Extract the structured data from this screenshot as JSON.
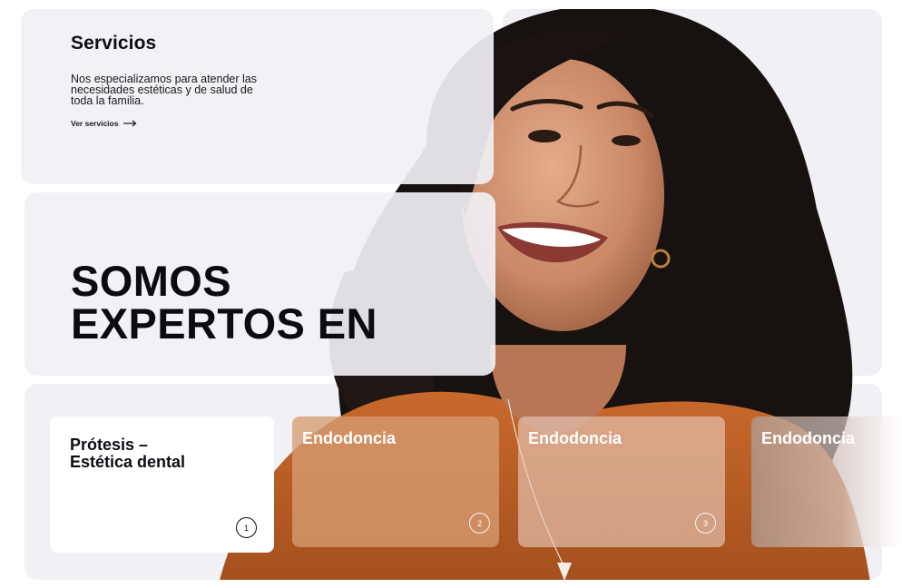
{
  "servicios": {
    "title": "Servicios",
    "description": "Nos especializamos para atender las necesidades estéticas y de salud de toda la familia.",
    "link_label": "Ver servicios",
    "link_icon": "arrow-right-icon"
  },
  "hero": {
    "heading": "SOMOS\nEXPERTOS EN"
  },
  "photo": {
    "subject": "smiling-woman-portrait"
  },
  "cards": [
    {
      "title": "Prótesis –\nEstética dental",
      "number": "1"
    },
    {
      "title": "Endodoncia",
      "number": "2"
    },
    {
      "title": "Endodoncia",
      "number": "3"
    },
    {
      "title": "Endodoncia",
      "number": ""
    }
  ],
  "colors": {
    "panel_bg": "#f1f0f5",
    "text_dark": "#0d0d14",
    "card_active_bg": "#ffffff",
    "card_2_bg": "#d69c72",
    "card_3_bg": "#e8cdc0",
    "shirt": "#c0652a"
  }
}
